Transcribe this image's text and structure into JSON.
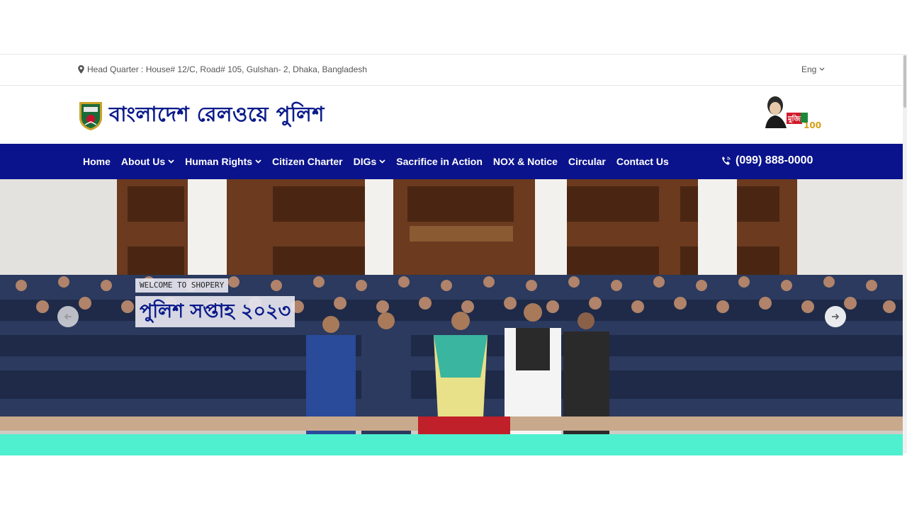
{
  "topbar": {
    "address": "Head Quarter : House# 12/C, Road# 105, Gulshan- 2, Dhaka, Bangladesh",
    "language": "Eng",
    "pin_icon": "map-pin-icon",
    "chevron_icon": "chevron-down-icon"
  },
  "header": {
    "site_title": "বাংলাদেশ রেলওয়ে পুলিশ",
    "logo_icon": "police-badge-icon",
    "mujib_logo_text": "মুজিব ১০০",
    "mujib_logo_number": "100"
  },
  "nav": {
    "items": [
      {
        "label": "Home",
        "dropdown": false
      },
      {
        "label": "About Us",
        "dropdown": true
      },
      {
        "label": "Human Rights",
        "dropdown": true
      },
      {
        "label": "Citizen Charter",
        "dropdown": false
      },
      {
        "label": "DIGs",
        "dropdown": true
      },
      {
        "label": "Sacrifice in Action",
        "dropdown": false
      },
      {
        "label": "NOX & Notice",
        "dropdown": false
      },
      {
        "label": "Circular",
        "dropdown": false
      },
      {
        "label": "Contact Us",
        "dropdown": false
      }
    ],
    "phone": "(099) 888-0000",
    "phone_icon": "phone-icon"
  },
  "hero": {
    "kicker": "WELCOME TO SHOPERY",
    "title": "পুলিশ সপ্তাহ ২০২৩",
    "prev_icon": "arrow-left-icon",
    "next_icon": "arrow-right-icon"
  },
  "colors": {
    "nav_bg": "#0a138c",
    "title_blue": "#0a1a8a",
    "carpet_green": "#4ff0cf"
  }
}
